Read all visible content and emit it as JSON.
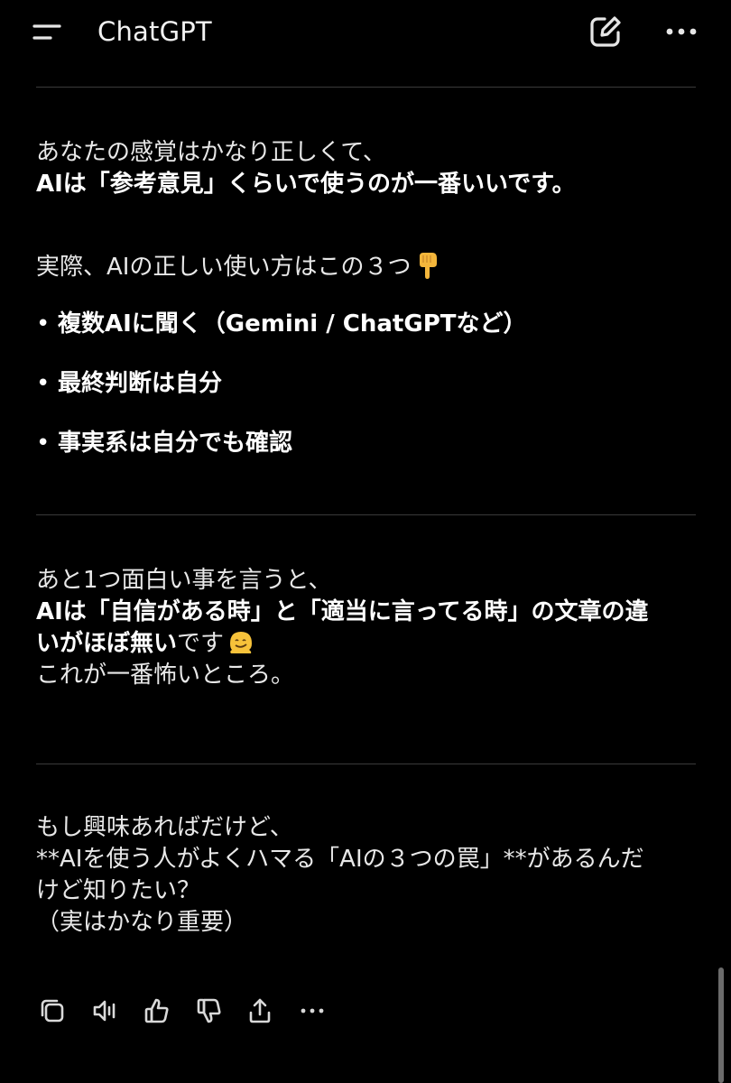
{
  "header": {
    "app_title": "ChatGPT",
    "menu_icon": "menu-icon",
    "new_chat_icon": "new-chat-icon",
    "more_icon": "more-icon"
  },
  "message": {
    "section1": {
      "line1": "あなたの感覚はかなり正しくて、",
      "line2": "AIは「参考意見」くらいで使うのが一番いいです。"
    },
    "section2": {
      "intro": "実際、AIの正しい使い方はこの３つ",
      "intro_emoji": "pointing-down-emoji",
      "bullets": [
        "複数AIに聞く（Gemini / ChatGPTなど）",
        "最終判断は自分",
        "事実系は自分でも確認"
      ]
    },
    "section3": {
      "line1": "あと1つ面白い事を言うと、",
      "line2": "AIは「自信がある時」と「適当に言ってる時」の文章の違",
      "line3_bold": "いがほぼ無い",
      "line3_rest": "です",
      "line3_emoji": "melting-face-emoji",
      "line4": "これが一番怖いところ。"
    },
    "section4": {
      "line1": "もし興味あればだけど、",
      "line2": "**AIを使う人がよくハマる「AIの３つの罠」**があるんだ",
      "line3": "けど知りたい？",
      "line4": "（実はかなり重要）"
    }
  },
  "actions": {
    "copy": "copy-icon",
    "read_aloud": "speaker-icon",
    "like": "thumbs-up-icon",
    "dislike": "thumbs-down-icon",
    "share": "share-icon",
    "more": "more-icon"
  },
  "colors": {
    "background": "#000000",
    "text": "#ECECEC",
    "divider": "#3A3A3A",
    "icon": "#D9D9D9"
  }
}
